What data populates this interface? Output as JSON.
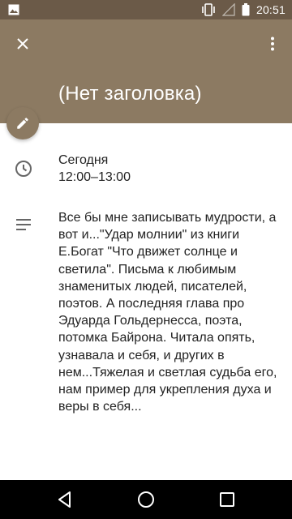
{
  "status_bar": {
    "time": "20:51",
    "icons": [
      "image-icon",
      "vibrate-icon",
      "signal-icon",
      "battery-icon"
    ]
  },
  "event": {
    "title": "(Нет заголовка)",
    "date_label": "Сегодня",
    "time_range": "12:00–13:00",
    "description": "Все бы мне записывать мудрости, а вот и...\"Удар молнии\" из книги Е.Богат \"Что движет солнце и светила\". Письма к любимым знаменитых людей, писателей, поэтов. А последняя глава про Эдуарда Гольдернесса, поэта, потомка Байрона. Читала опять, узнавала и себя, и других в нем...Тяжелая и светлая судьба его, нам пример для укрепления духа и веры в себя..."
  },
  "colors": {
    "header": "#8c7a62",
    "status_bar": "#6b5a48"
  },
  "nav": {
    "icons": [
      "back-icon",
      "home-icon",
      "recents-icon"
    ]
  }
}
